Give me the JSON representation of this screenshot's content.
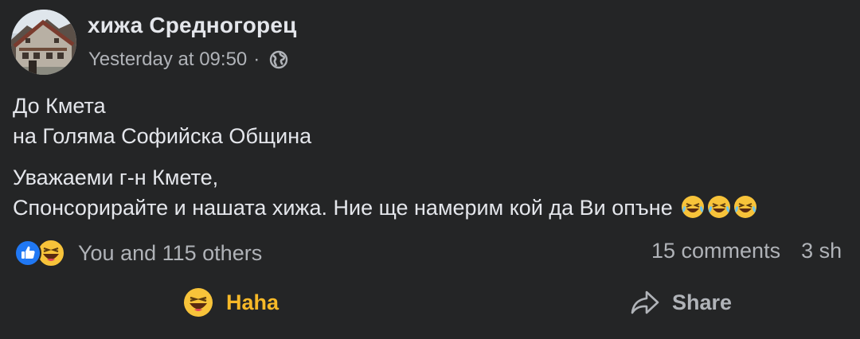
{
  "post": {
    "author": "хижа Средногорец",
    "timestamp": "Yesterday at 09:50",
    "separator": "·",
    "audience_icon": "globe-icon",
    "lines": [
      "До Кмета",
      "на Голяма Софийска Община",
      "Уважаеми г-н Кмете,",
      "Спонсорирайте и нашата хижа. Ние ще намерим кой да Ви опъне"
    ],
    "trailing_emoji": [
      "laugh-emoji",
      "laugh-emoji",
      "laugh-emoji"
    ]
  },
  "reactions": {
    "icons": [
      "like-reaction-icon",
      "haha-reaction-icon"
    ],
    "summary": "You and 115 others",
    "comments": "15 comments",
    "shares": "3 sh"
  },
  "actions": {
    "reaction_label": "Haha",
    "share_label": "Share"
  },
  "colors": {
    "background": "#242526",
    "text_primary": "#e4e6eb",
    "text_secondary": "#b0b3b8",
    "haha_yellow": "#f7b928",
    "like_blue": "#2078f4"
  }
}
